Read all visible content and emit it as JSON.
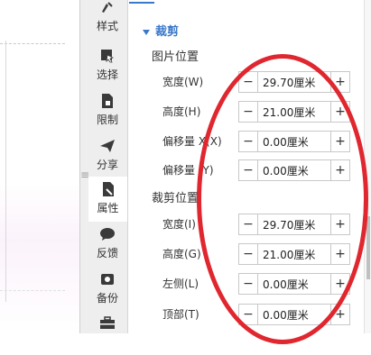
{
  "tools": [
    {
      "label": "样式",
      "icon": "style-brush-icon"
    },
    {
      "label": "选择",
      "icon": "select-cursor-icon"
    },
    {
      "label": "限制",
      "icon": "restrict-doc-icon"
    },
    {
      "label": "分享",
      "icon": "share-plane-icon"
    },
    {
      "label": "属性",
      "icon": "properties-doc-icon"
    },
    {
      "label": "反馈",
      "icon": "feedback-bubble-icon"
    },
    {
      "label": "备份",
      "icon": "backup-icon"
    },
    {
      "label": "",
      "icon": "toolbox-icon"
    }
  ],
  "drag_handle": "≡",
  "crop": {
    "header": "裁剪",
    "image_position_label": "图片位置",
    "crop_position_label": "裁剪位置",
    "rows": [
      {
        "label": "宽度(W)",
        "value": "29.70厘米"
      },
      {
        "label": "高度(H)",
        "value": "21.00厘米"
      },
      {
        "label": "偏移量 X(X)",
        "value": "0.00厘米"
      },
      {
        "label": "偏移量 (Y)",
        "value": "0.00厘米"
      },
      {
        "label": "宽度(I)",
        "value": "29.70厘米"
      },
      {
        "label": "高度(G)",
        "value": "21.00厘米"
      },
      {
        "label": "左侧(L)",
        "value": "0.00厘米"
      },
      {
        "label": "顶部(T)",
        "value": "0.00厘米"
      }
    ],
    "minus": "−",
    "plus": "+"
  },
  "colors": {
    "accent": "#3a78c8",
    "annotation": "#e0262e"
  }
}
